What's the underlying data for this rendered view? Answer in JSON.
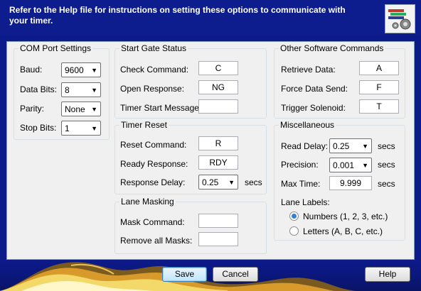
{
  "header": {
    "instructions": "Refer to the Help file for instructions on setting these options to communicate with your timer."
  },
  "com_port": {
    "title": "COM Port Settings",
    "baud_label": "Baud:",
    "baud_value": "9600",
    "data_bits_label": "Data Bits:",
    "data_bits_value": "8",
    "parity_label": "Parity:",
    "parity_value": "None",
    "stop_bits_label": "Stop Bits:",
    "stop_bits_value": "1"
  },
  "start_gate": {
    "title": "Start Gate Status",
    "check_command_label": "Check Command:",
    "check_command_value": "C",
    "open_response_label": "Open Response:",
    "open_response_value": "NG",
    "timer_start_label": "Timer Start Message:",
    "timer_start_value": ""
  },
  "timer_reset": {
    "title": "Timer Reset",
    "reset_command_label": "Reset Command:",
    "reset_command_value": "R",
    "ready_response_label": "Ready Response:",
    "ready_response_value": "RDY",
    "response_delay_label": "Response Delay:",
    "response_delay_value": "0.25",
    "response_delay_unit": "secs"
  },
  "lane_masking": {
    "title": "Lane Masking",
    "mask_command_label": "Mask Command:",
    "mask_command_value": "",
    "remove_masks_label": "Remove all Masks:",
    "remove_masks_value": ""
  },
  "other_commands": {
    "title": "Other Software Commands",
    "retrieve_label": "Retrieve Data:",
    "retrieve_value": "A",
    "force_send_label": "Force Data Send:",
    "force_send_value": "F",
    "trigger_label": "Trigger Solenoid:",
    "trigger_value": "T"
  },
  "misc": {
    "title": "Miscellaneous",
    "read_delay_label": "Read Delay:",
    "read_delay_value": "0.25",
    "read_delay_unit": "secs",
    "precision_label": "Precision:",
    "precision_value": "0.001",
    "precision_unit": "secs",
    "max_time_label": "Max Time:",
    "max_time_value": "9.999",
    "max_time_unit": "secs",
    "lane_labels_label": "Lane Labels:",
    "numbers_option": "Numbers (1, 2, 3, etc.)",
    "letters_option": "Letters (A, B, C, etc.)",
    "selected_option": "numbers"
  },
  "buttons": {
    "save": "Save",
    "cancel": "Cancel",
    "help": "Help"
  },
  "colors": {
    "header_bg": "#0d1d8e",
    "panel_bg": "#f0f0f0",
    "radio_selected": "#2f7fd8"
  },
  "icons": {
    "header": "timer-settings-icon",
    "dropdown": "chevron-down-icon"
  }
}
